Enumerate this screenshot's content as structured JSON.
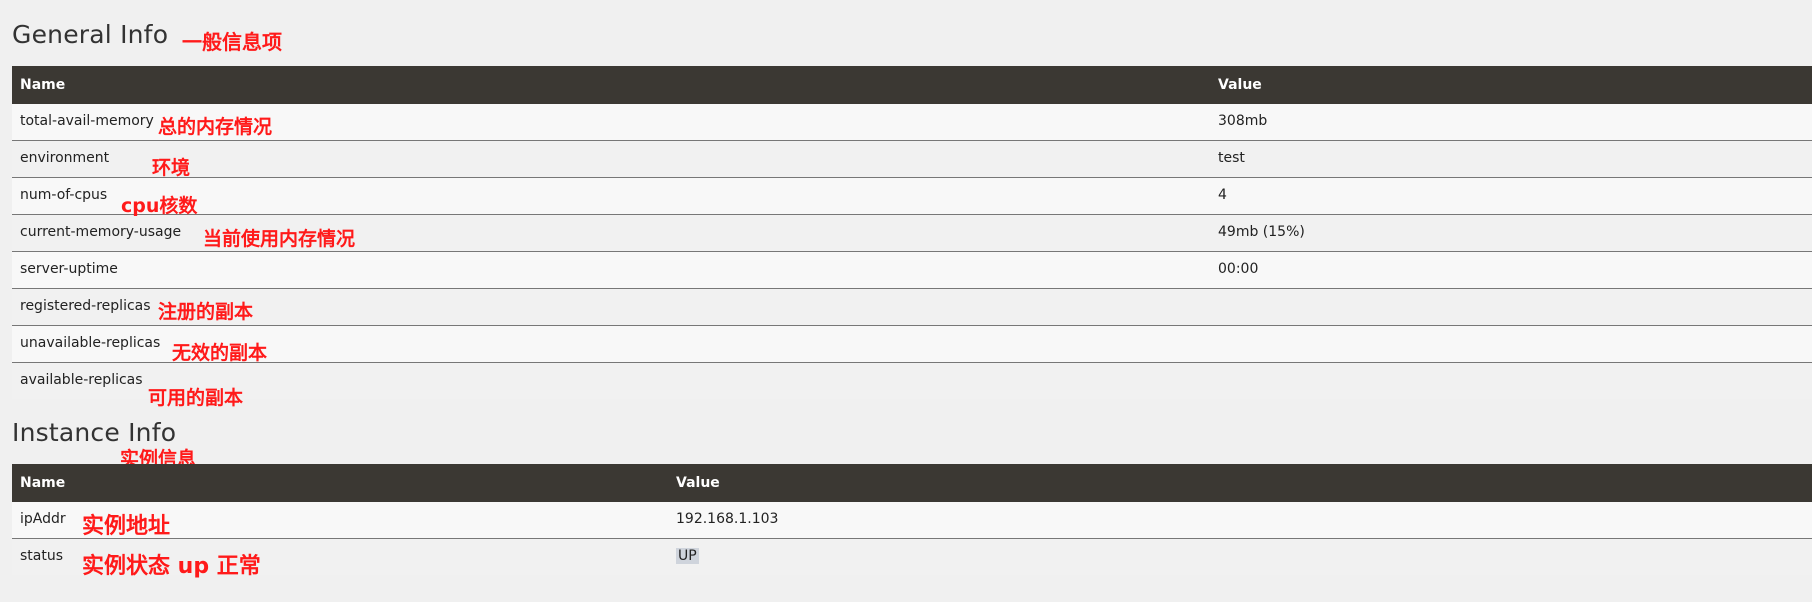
{
  "general": {
    "title": "General Info",
    "title_annotation": "一般信息项",
    "header": {
      "name": "Name",
      "value": "Value"
    },
    "rows": [
      {
        "name": "total-avail-memory",
        "value": "308mb",
        "annotation": "总的内存情况"
      },
      {
        "name": "environment",
        "value": "test",
        "annotation": "环境"
      },
      {
        "name": "num-of-cpus",
        "value": "4",
        "annotation": "cpu核数"
      },
      {
        "name": "current-memory-usage",
        "value": "49mb (15%)",
        "annotation": "当前使用内存情况"
      },
      {
        "name": "server-uptime",
        "value": "00:00",
        "annotation": ""
      },
      {
        "name": "registered-replicas",
        "value": "",
        "annotation": "注册的副本"
      },
      {
        "name": "unavailable-replicas",
        "value": "",
        "annotation": "无效的副本"
      },
      {
        "name": "available-replicas",
        "value": "",
        "annotation": "可用的副本"
      }
    ]
  },
  "instance": {
    "title": "Instance Info",
    "title_annotation": "实例信息",
    "header": {
      "name": "Name",
      "value": "Value"
    },
    "rows": [
      {
        "name": "ipAddr",
        "value": "192.168.1.103",
        "annotation": "实例地址"
      },
      {
        "name": "status",
        "value": "UP",
        "annotation": "实例状态 up 正常"
      }
    ]
  },
  "colors": {
    "header_bg": "#3b3833",
    "annotation": "#ff1a1a",
    "page_bg": "#f0f0f0"
  }
}
